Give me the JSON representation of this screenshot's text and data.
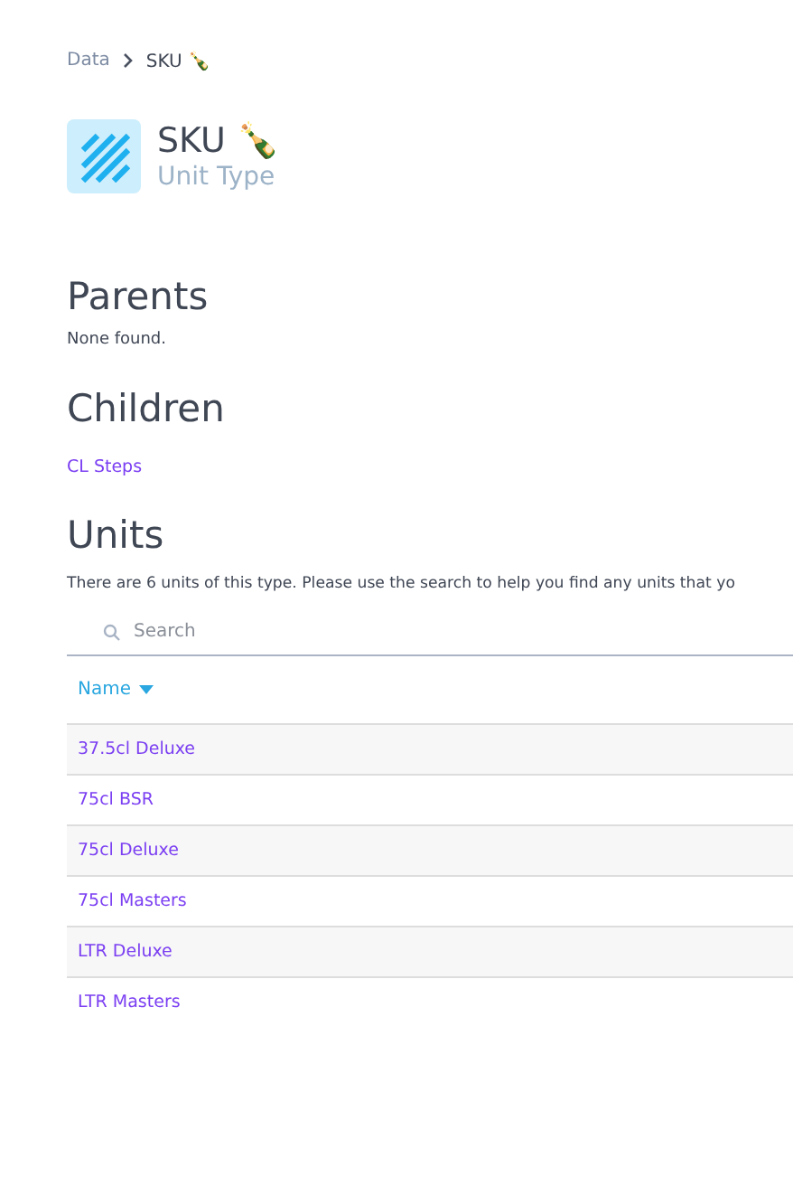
{
  "breadcrumb": {
    "items": [
      "Data",
      "SKU 🍾"
    ]
  },
  "header": {
    "title": "SKU 🍾",
    "subtitle": "Unit Type"
  },
  "parents": {
    "heading": "Parents",
    "empty_text": "None found."
  },
  "children": {
    "heading": "Children",
    "links": [
      "CL Steps"
    ]
  },
  "units": {
    "heading": "Units",
    "description": "There are 6 units of this type. Please use the search to help you find any units that yo",
    "search": {
      "placeholder": "Search"
    },
    "table": {
      "columns": [
        {
          "label": "Name",
          "sorted": true
        }
      ],
      "rows": [
        {
          "name": "37.5cl Deluxe"
        },
        {
          "name": "75cl BSR"
        },
        {
          "name": "75cl Deluxe"
        },
        {
          "name": "75cl Masters"
        },
        {
          "name": "LTR Deluxe"
        },
        {
          "name": "LTR Masters"
        }
      ]
    }
  }
}
